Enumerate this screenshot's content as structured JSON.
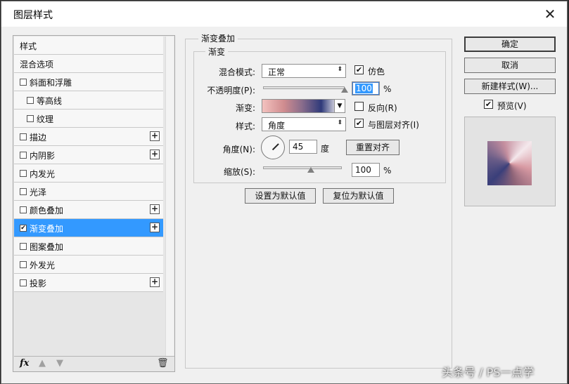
{
  "window": {
    "title": "图层样式",
    "close_glyph": "✕"
  },
  "styles_list": {
    "items": [
      {
        "label": "样式",
        "checkbox": false,
        "checked": false,
        "plus": false,
        "indent": 0,
        "selected": false
      },
      {
        "label": "混合选项",
        "checkbox": false,
        "checked": false,
        "plus": false,
        "indent": 0,
        "selected": false
      },
      {
        "label": "斜面和浮雕",
        "checkbox": true,
        "checked": false,
        "plus": false,
        "indent": 0,
        "selected": false
      },
      {
        "label": "等高线",
        "checkbox": true,
        "checked": false,
        "plus": false,
        "indent": 1,
        "selected": false
      },
      {
        "label": "纹理",
        "checkbox": true,
        "checked": false,
        "plus": false,
        "indent": 1,
        "selected": false
      },
      {
        "label": "描边",
        "checkbox": true,
        "checked": false,
        "plus": true,
        "indent": 0,
        "selected": false
      },
      {
        "label": "内阴影",
        "checkbox": true,
        "checked": false,
        "plus": true,
        "indent": 0,
        "selected": false
      },
      {
        "label": "内发光",
        "checkbox": true,
        "checked": false,
        "plus": false,
        "indent": 0,
        "selected": false
      },
      {
        "label": "光泽",
        "checkbox": true,
        "checked": false,
        "plus": false,
        "indent": 0,
        "selected": false
      },
      {
        "label": "颜色叠加",
        "checkbox": true,
        "checked": false,
        "plus": true,
        "indent": 0,
        "selected": false
      },
      {
        "label": "渐变叠加",
        "checkbox": true,
        "checked": true,
        "plus": true,
        "indent": 0,
        "selected": true
      },
      {
        "label": "图案叠加",
        "checkbox": true,
        "checked": false,
        "plus": false,
        "indent": 0,
        "selected": false
      },
      {
        "label": "外发光",
        "checkbox": true,
        "checked": false,
        "plus": false,
        "indent": 0,
        "selected": false
      },
      {
        "label": "投影",
        "checkbox": true,
        "checked": false,
        "plus": true,
        "indent": 0,
        "selected": false
      }
    ],
    "footer": {
      "fx_label": "fx",
      "up_icon": "▲",
      "down_icon": "▼",
      "trash_icon": "🗑"
    }
  },
  "gradient_overlay": {
    "group_title": "渐变叠加",
    "subgroup_title": "渐变",
    "blend_mode": {
      "label": "混合模式:",
      "value": "正常"
    },
    "dither": {
      "label": "仿色",
      "checked": true
    },
    "opacity": {
      "label": "不透明度(P):",
      "value": "100",
      "unit": "%",
      "level": 1.0
    },
    "gradient": {
      "label": "渐变:"
    },
    "reverse": {
      "label": "反向(R)",
      "checked": false
    },
    "style": {
      "label": "样式:",
      "value": "角度"
    },
    "align_with_layer": {
      "label": "与图层对齐(I)",
      "checked": true
    },
    "angle": {
      "label": "角度(N):",
      "value": "45",
      "unit": "度"
    },
    "reset_align_button": "重置对齐",
    "scale": {
      "label": "缩放(S):",
      "value": "100",
      "unit": "%",
      "level": 0.5
    },
    "set_default_button": "设置为默认值",
    "reset_default_button": "复位为默认值"
  },
  "right_panel": {
    "ok_button": "确定",
    "cancel_button": "取消",
    "new_style_button": "新建样式(W)...",
    "preview": {
      "label": "预览(V)",
      "checked": true
    }
  },
  "watermark": "头条号 / PS一点学"
}
